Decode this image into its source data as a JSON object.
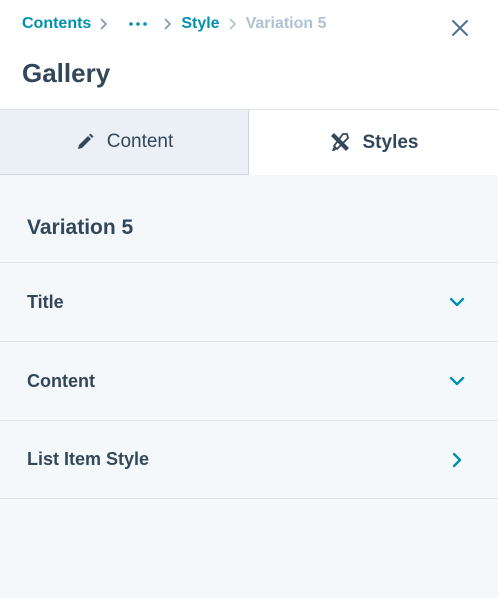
{
  "breadcrumb": {
    "contents": "Contents",
    "more": "···",
    "style": "Style",
    "current": "Variation 5"
  },
  "header": {
    "title": "Gallery"
  },
  "tabs": [
    {
      "label": "Content",
      "icon": "pencil-icon",
      "active": false
    },
    {
      "label": "Styles",
      "icon": "brush-ruler-icon",
      "active": true
    }
  ],
  "section": {
    "title": "Variation 5"
  },
  "rows": [
    {
      "label": "Title",
      "icon": "chevron-down-icon"
    },
    {
      "label": "Content",
      "icon": "chevron-down-icon"
    },
    {
      "label": "List Item Style",
      "icon": "chevron-right-icon"
    }
  ],
  "colors": {
    "accent": "#0091ae",
    "text": "#33475b",
    "muted": "#b0c1d4",
    "panel": "#f5f8fa"
  }
}
